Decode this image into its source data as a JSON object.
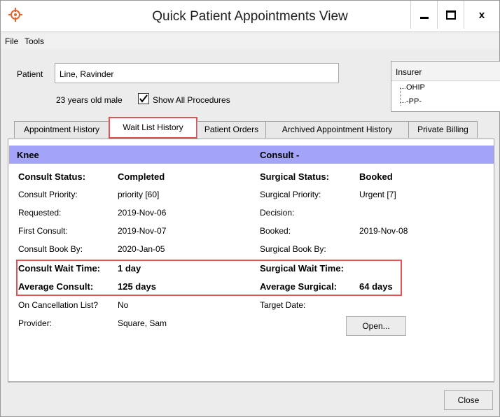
{
  "window": {
    "title": "Quick Patient Appointments View",
    "app_icon": "target-icon",
    "controls": {
      "minimize": "▁",
      "maximize": "□",
      "close": "✕"
    }
  },
  "menu": {
    "file": "File",
    "tools": "Tools"
  },
  "patient": {
    "label": "Patient",
    "name": "Line, Ravinder",
    "info": "23 years old male",
    "show_all_label": "Show All Procedures",
    "show_all_checked": true
  },
  "insurer": {
    "header": "Insurer",
    "items": [
      "OHIP",
      "-PP-"
    ]
  },
  "tabs": [
    {
      "label": "Appointment History"
    },
    {
      "label": "Wait List History",
      "active": true
    },
    {
      "label": "Patient Orders"
    },
    {
      "label": "Archived Appointment History"
    },
    {
      "label": "Private Billing"
    }
  ],
  "waitlist": {
    "left_header": "Knee",
    "right_header": "Consult -",
    "left": {
      "consult_status_label": "Consult Status:",
      "consult_status_value": "Completed",
      "consult_priority_label": "Consult Priority:",
      "consult_priority_value": "priority [60]",
      "requested_label": "Requested:",
      "requested_value": "2019-Nov-06",
      "first_consult_label": "First Consult:",
      "first_consult_value": "2019-Nov-07",
      "consult_book_by_label": "Consult Book By:",
      "consult_book_by_value": "2020-Jan-05",
      "consult_wait_label": "Consult Wait Time:",
      "consult_wait_value": "1 day",
      "average_consult_label": "Average Consult:",
      "average_consult_value": "125 days",
      "cancellation_label": "On Cancellation List?",
      "cancellation_value": "No",
      "provider_label": "Provider:",
      "provider_value": "Square, Sam"
    },
    "right": {
      "surgical_status_label": "Surgical Status:",
      "surgical_status_value": "Booked",
      "surgical_priority_label": "Surgical Priority:",
      "surgical_priority_value": "Urgent [7]",
      "decision_label": "Decision:",
      "booked_label": "Booked:",
      "booked_value": "2019-Nov-08",
      "surgical_book_by_label": "Surgical Book By:",
      "surgical_wait_label": "Surgical Wait Time:",
      "average_surgical_label": "Average Surgical:",
      "average_surgical_value": "64 days",
      "target_date_label": "Target Date:"
    },
    "open_button": "Open..."
  },
  "footer": {
    "close_button": "Close"
  },
  "colors": {
    "header_band": "#a3a4f7",
    "highlight": "#e25454"
  }
}
